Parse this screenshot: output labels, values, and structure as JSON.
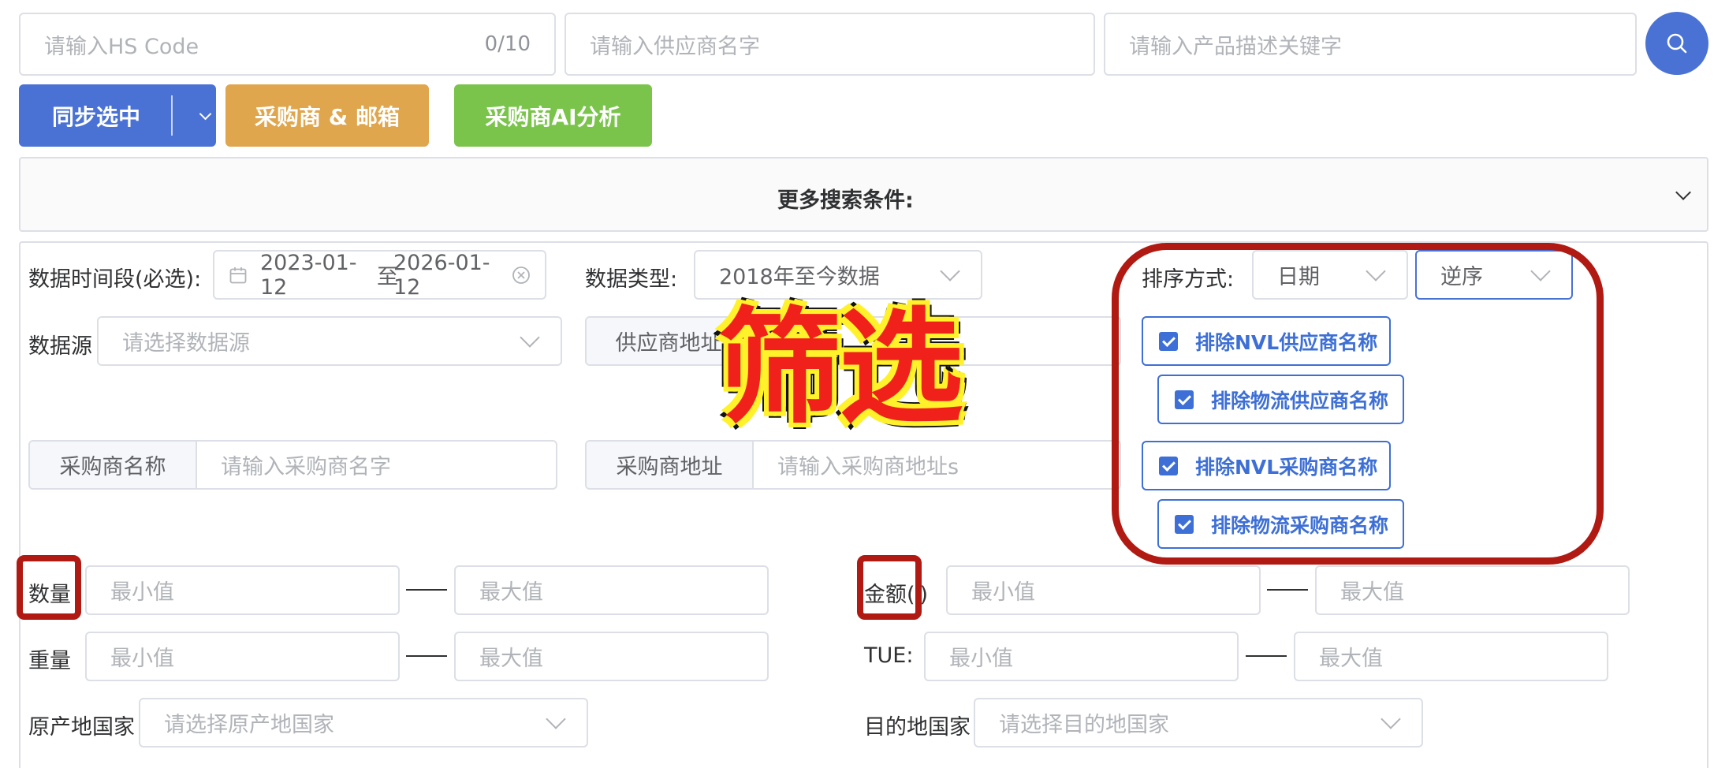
{
  "top_search": {
    "hs_code_placeholder": "请输入HS Code",
    "hs_code_counter": "0/10",
    "supplier_placeholder": "请输入供应商名字",
    "product_placeholder": "请输入产品描述关键字"
  },
  "actions": {
    "sync_selected": "同步选中",
    "buyer_email": "采购商 & 邮箱",
    "buyer_ai": "采购商AI分析"
  },
  "more_conditions": {
    "title": "更多搜索条件:"
  },
  "filters": {
    "date_range_label": "数据时间段(必选):",
    "date_start": "2023-01-12",
    "date_sep": "至",
    "date_end": "2026-01-12",
    "data_type_label": "数据类型:",
    "data_type_value": "2018年至今数据",
    "sort_label": "排序方式:",
    "sort_field": "日期",
    "sort_order": "逆序",
    "data_source_label": "数据源",
    "data_source_placeholder": "请选择数据源",
    "supplier_address_prefix": "供应商地址",
    "buyer_name_prefix": "采购商名称",
    "buyer_name_placeholder": "请输入采购商名字",
    "buyer_address_prefix": "采购商地址",
    "buyer_address_placeholder": "请输入采购商地址s",
    "exclude_nvl_supplier": "排除NVL供应商名称",
    "exclude_logistics_supplier": "排除物流供应商名称",
    "exclude_nvl_buyer": "排除NVL采购商名称",
    "exclude_logistics_buyer": "排除物流采购商名称",
    "quantity_label": "数量",
    "amount_label": "金额(",
    "amount_label_end": ")",
    "weight_label": "重量",
    "teu_label": "TUE:",
    "min_placeholder": "最小值",
    "max_placeholder": "最大值",
    "origin_label": "原产地国家",
    "origin_placeholder": "请选择原产地国家",
    "dest_label": "目的地国家",
    "dest_placeholder": "请选择目的地国家"
  },
  "overlay": {
    "text": "筛选"
  },
  "colors": {
    "primary": "#4a72d4",
    "orange": "#dfa64d",
    "green": "#7bc44c",
    "annotation_red": "#b01a12",
    "overlay_text": "#f0201a",
    "overlay_outline": "#fff12a"
  }
}
